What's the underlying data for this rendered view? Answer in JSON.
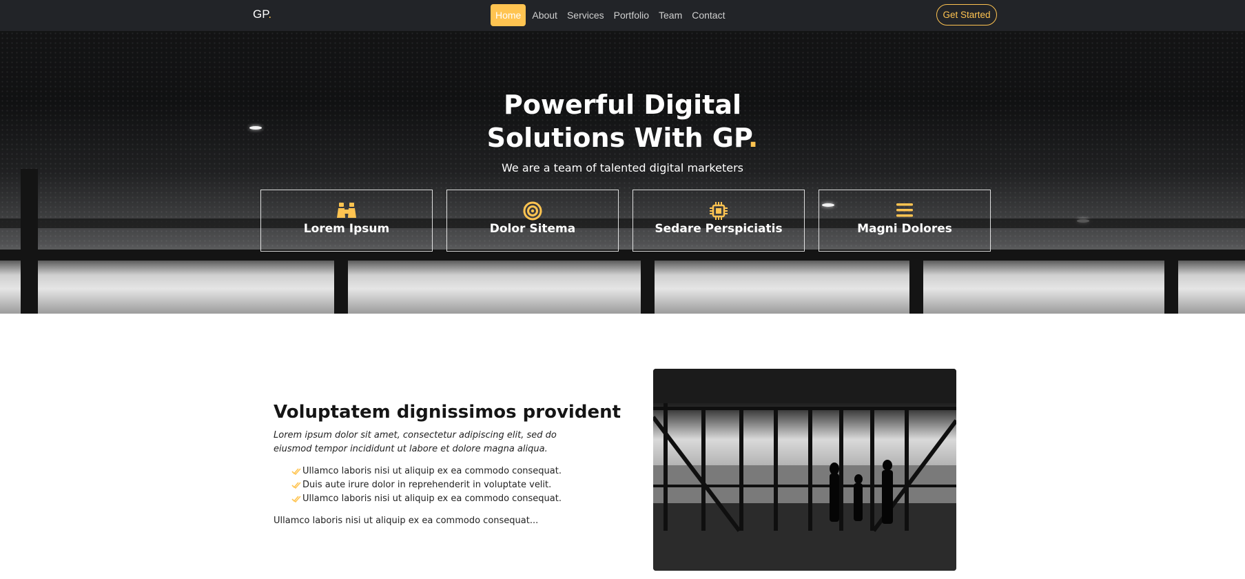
{
  "header": {
    "logo_text": "GP",
    "logo_dot": ".",
    "nav": [
      "Home",
      "About",
      "Services",
      "Portfolio",
      "Team",
      "Contact"
    ],
    "active_nav": "Home",
    "cta_label": "Get Started"
  },
  "hero": {
    "title_line1": "Powerful Digital",
    "title_line2": "Solutions With GP",
    "title_dot": ".",
    "subtitle": "We are a team of talented digital marketers",
    "boxes": [
      {
        "label": "Lorem Ipsum",
        "icon": "binoculars-icon"
      },
      {
        "label": "Dolor Sitema",
        "icon": "bullseye-icon"
      },
      {
        "label": "Sedare Perspiciatis",
        "icon": "cpu-chip-icon"
      },
      {
        "label": "Magni Dolores",
        "icon": "menu-lines-icon"
      }
    ]
  },
  "about": {
    "title": "Voluptatem dignissimos provident",
    "lead": "Lorem ipsum dolor sit amet, consectetur adipiscing elit, sed do eiusmod tempor incididunt ut labore et dolore magna aliqua.",
    "list": [
      "Ullamco laboris nisi ut aliquip ex ea commodo consequat.",
      "Duis aute irure dolor in reprehenderit in voluptate velit.",
      "Ullamco laboris nisi ut aliquip ex ea commodo consequat."
    ],
    "footer": "Ullamco laboris nisi ut aliquip ex ea commodo consequat..."
  },
  "colors": {
    "accent": "#ffc451",
    "header_bg": "#222428"
  }
}
